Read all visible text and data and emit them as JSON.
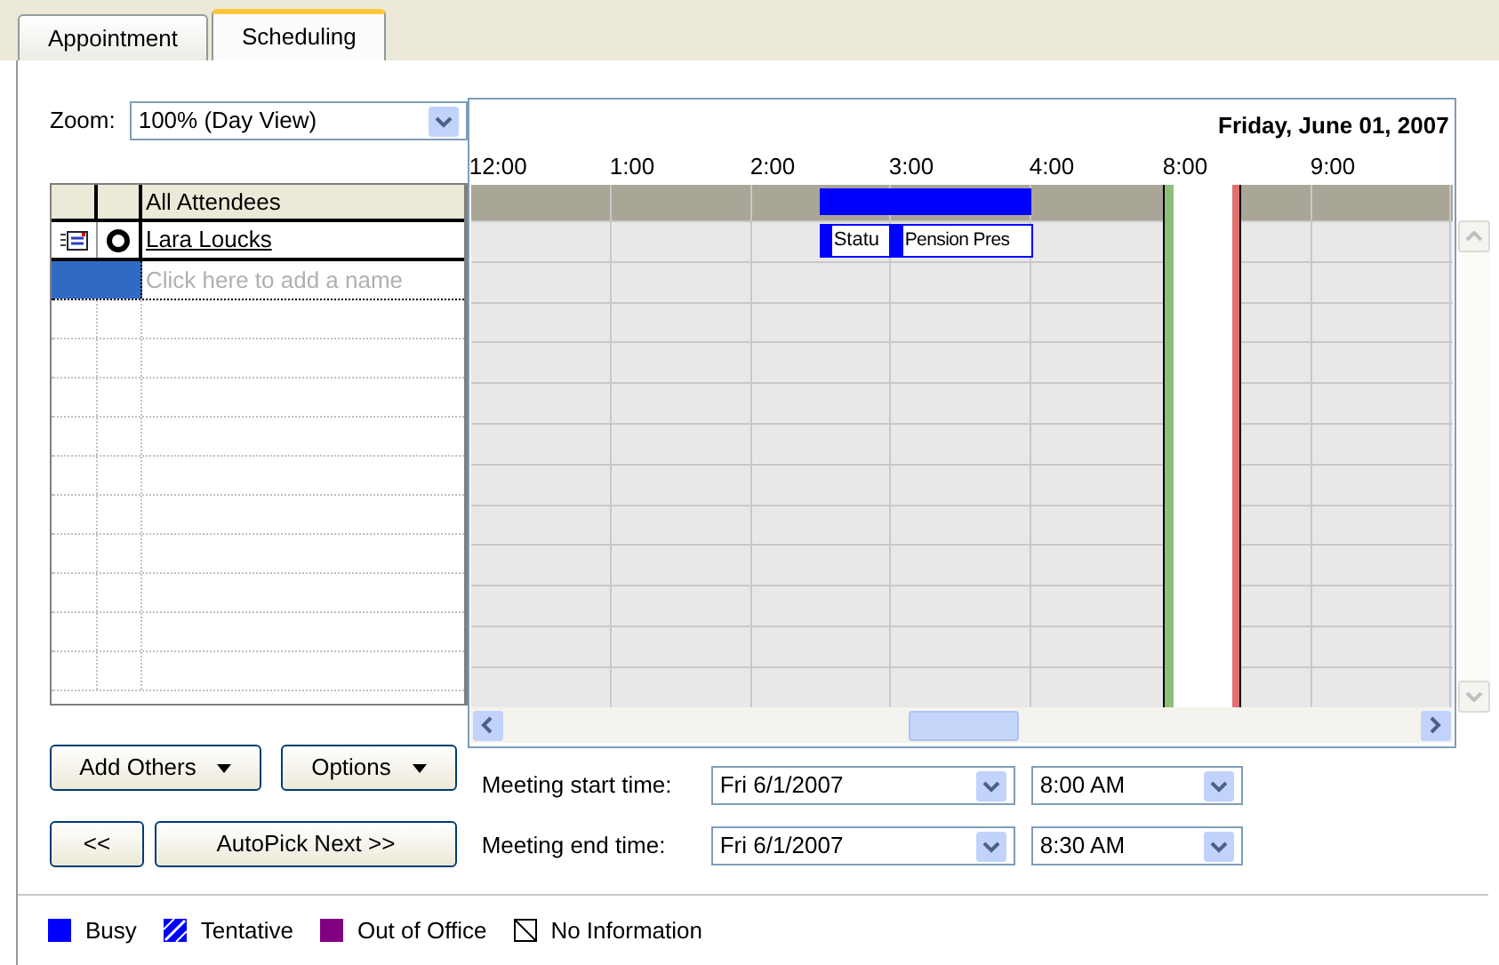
{
  "tabs": [
    {
      "label": "Appointment",
      "selected": false
    },
    {
      "label": "Scheduling",
      "selected": true
    }
  ],
  "zoom": {
    "label": "Zoom:",
    "value": "100% (Day View)"
  },
  "attendees": {
    "header": "All Attendees",
    "rows": [
      {
        "name": "Lara Loucks"
      }
    ],
    "placeholder": "Click here to add a name"
  },
  "timeline": {
    "date": "Friday, June 01, 2007",
    "hours": [
      "12:00",
      "1:00",
      "2:00",
      "3:00",
      "4:00",
      "8:00",
      "9:00"
    ],
    "attendee_events": [
      {
        "label": "Statu"
      },
      {
        "label": "Pension Pres"
      }
    ]
  },
  "buttons": {
    "add_others": "Add Others",
    "options": "Options",
    "previous": "<<",
    "autopick": "AutoPick Next >>"
  },
  "meeting": [
    {
      "label": "Meeting start time:",
      "date": "Fri 6/1/2007",
      "time": "8:00 AM"
    },
    {
      "label": "Meeting end time:",
      "date": "Fri 6/1/2007",
      "time": "8:30 AM"
    }
  ],
  "legend": [
    {
      "kind": "busy",
      "label": "Busy",
      "color": "#0000ff"
    },
    {
      "kind": "tentative",
      "label": "Tentative",
      "color": "#0000ff"
    },
    {
      "kind": "out_of_office",
      "label": "Out of Office",
      "color": "#800080"
    },
    {
      "kind": "no_information",
      "label": "No Information",
      "color": "#ffffff"
    }
  ]
}
